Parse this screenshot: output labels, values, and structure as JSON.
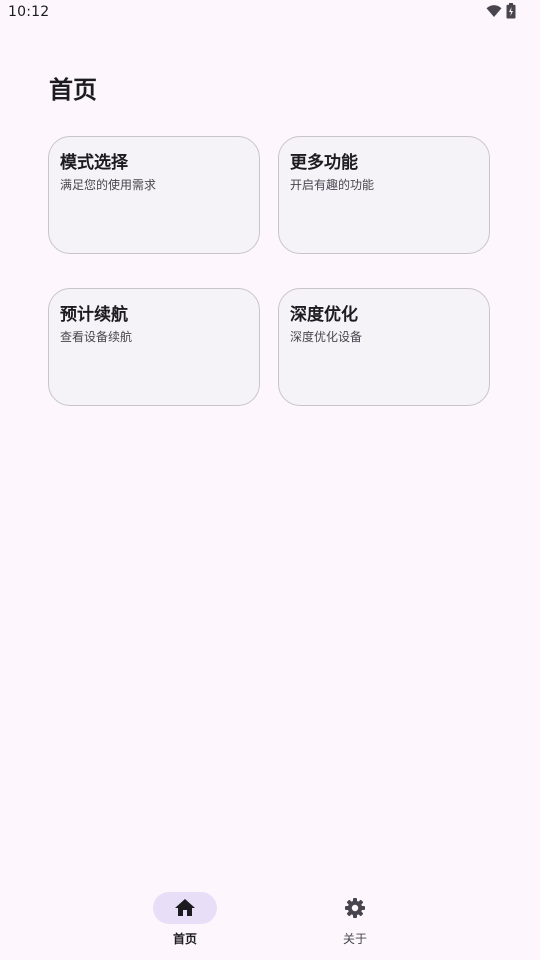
{
  "status_bar": {
    "time": "10:12",
    "icons": [
      "wifi-icon",
      "battery-icon"
    ]
  },
  "header": {
    "title": "首页"
  },
  "cards": [
    {
      "title": "模式选择",
      "subtitle": "满足您的使用需求"
    },
    {
      "title": "更多功能",
      "subtitle": "开启有趣的功能"
    },
    {
      "title": "预计续航",
      "subtitle": "查看设备续航"
    },
    {
      "title": "深度优化",
      "subtitle": "深度优化设备"
    }
  ],
  "bottom_nav": {
    "items": [
      {
        "label": "首页",
        "icon": "home-icon",
        "selected": true
      },
      {
        "label": "关于",
        "icon": "gear-icon",
        "selected": false
      }
    ]
  },
  "colors": {
    "background": "#fdf7fd",
    "card_background": "#f5f3f7",
    "card_border": "#c8c5ca",
    "nav_indicator": "#e8def8",
    "text_primary": "#1c1b1f",
    "text_secondary": "#49454f"
  }
}
